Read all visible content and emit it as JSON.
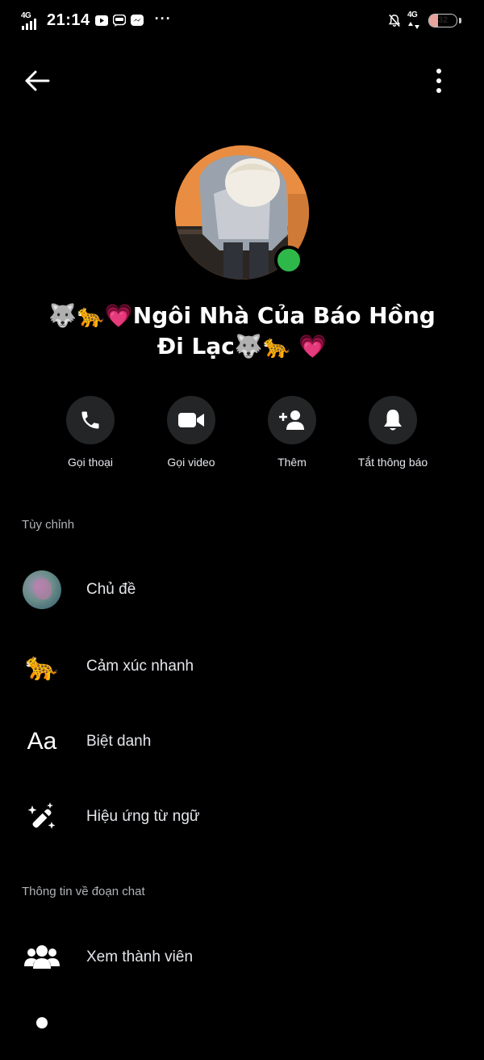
{
  "status_bar": {
    "network_left": "4G",
    "time": "21:14",
    "more_indicator": "···",
    "network_right": "4G",
    "battery_level": "32",
    "battery_fraction": 0.32
  },
  "nav": {
    "back_icon": "arrow-left-icon",
    "more_icon": "vertical-dots-icon"
  },
  "profile": {
    "online": true,
    "group_name": "🐺🐆💗Ngôi Nhà Của Báo Hồng Đi Lạc🐺🐆 💗"
  },
  "actions": [
    {
      "label": "Gọi thoại",
      "icon": "phone-icon"
    },
    {
      "label": "Gọi video",
      "icon": "video-camera-icon"
    },
    {
      "label": "Thêm",
      "icon": "add-person-icon"
    },
    {
      "label": "Tắt thông báo",
      "icon": "bell-icon"
    }
  ],
  "sections": {
    "customize_title": "Tùy chỉnh",
    "chat_info_title": "Thông tin về đoạn chat"
  },
  "customize_items": [
    {
      "label": "Chủ đề",
      "icon": "theme-circle-icon"
    },
    {
      "label": "Cảm xúc nhanh",
      "icon": "leopard-emoji-icon",
      "emoji": "🐆"
    },
    {
      "label": "Biệt danh",
      "icon": "aa-text-icon",
      "glyph": "Aa"
    },
    {
      "label": "Hiệu ứng từ ngữ",
      "icon": "magic-wand-icon"
    }
  ],
  "chat_info_items": [
    {
      "label": "Xem thành viên",
      "icon": "people-icon"
    }
  ],
  "colors": {
    "background": "#000000",
    "circle_button": "#242526",
    "online": "#2eb84a",
    "secondary_text": "#b0b3b8"
  }
}
